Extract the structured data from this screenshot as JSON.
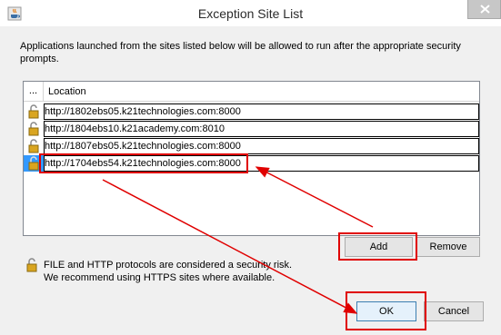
{
  "window": {
    "title": "Exception Site List"
  },
  "description": "Applications launched from the sites listed below will be allowed to run after the appropriate security prompts.",
  "table": {
    "headers": [
      "...",
      "Location"
    ],
    "rows": [
      {
        "location": "http://1802ebs05.k21technologies.com:8000",
        "selected": false
      },
      {
        "location": "http://1804ebs10.k21academy.com:8010",
        "selected": false
      },
      {
        "location": "http://1807ebs05.k21technologies.com:8000",
        "selected": false
      },
      {
        "location": "http://1704ebs54.k21technologies.com:8000",
        "selected": true
      }
    ]
  },
  "buttons": {
    "add": "Add",
    "remove": "Remove",
    "ok": "OK",
    "cancel": "Cancel"
  },
  "note": {
    "line1": "FILE and HTTP protocols are considered a security risk.",
    "line2": "We recommend using HTTPS sites where available."
  },
  "icons": {
    "title": "java-cup-icon",
    "row": "lock-icon",
    "note": "lock-icon"
  },
  "colors": {
    "annotation": "#e00000",
    "selection": "#3399ff"
  }
}
